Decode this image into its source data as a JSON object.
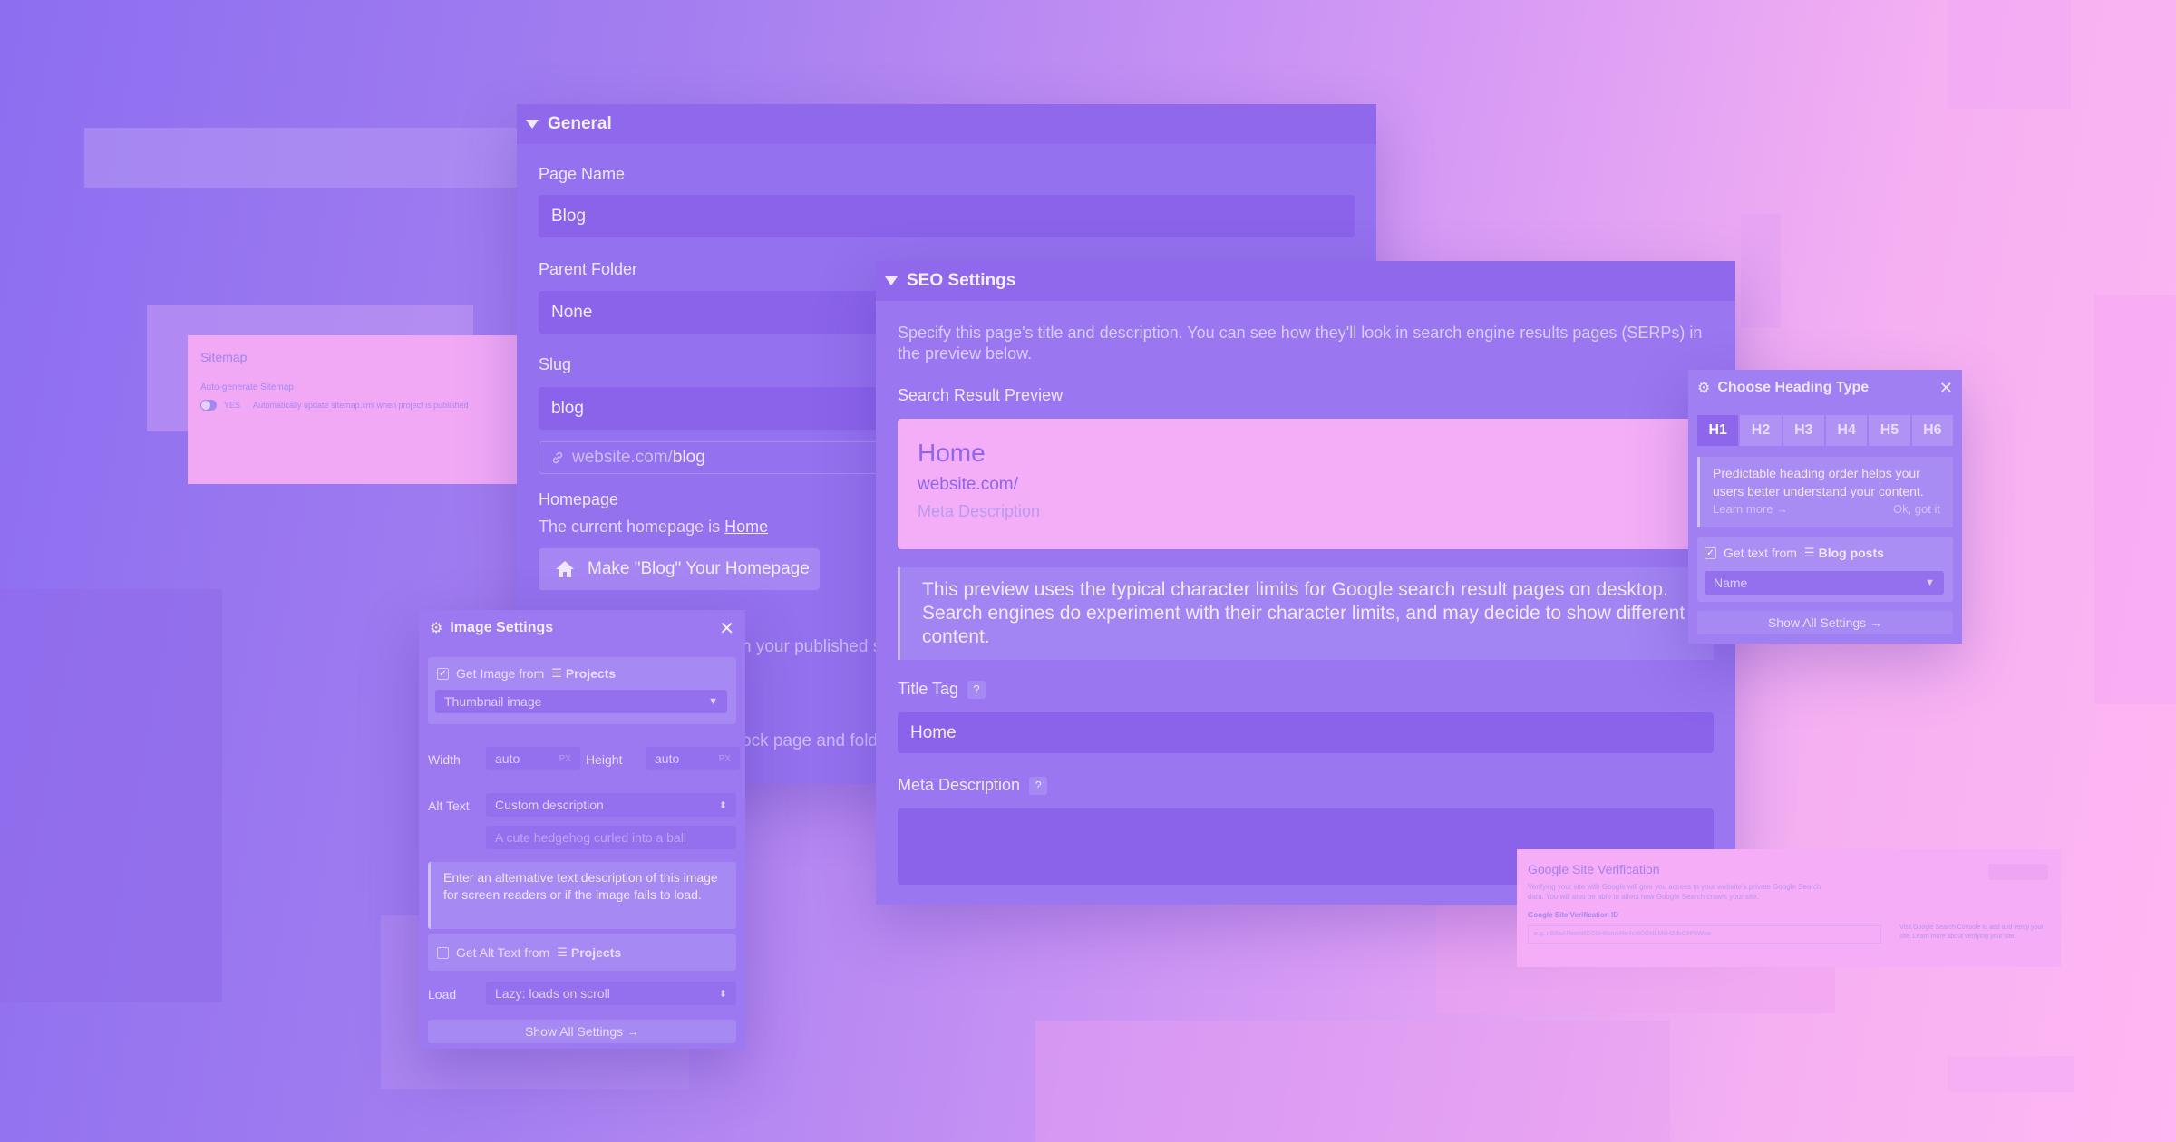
{
  "general": {
    "title": "General",
    "page_name_label": "Page Name",
    "page_name_value": "Blog",
    "parent_folder_label": "Parent Folder",
    "parent_folder_value": "None",
    "slug_label": "Slug",
    "slug_value": "blog",
    "slug_url_prefix": "website.com/",
    "slug_url_slug": "blog",
    "homepage_label": "Homepage",
    "homepage_text": "The current homepage is ",
    "homepage_link": "Home",
    "make_home_button": "Make \"Blog\" Your Homepage",
    "partial_text_1": "n your published s",
    "partial_text_2": "ock page and fold"
  },
  "sitemap": {
    "title": "Sitemap",
    "subtitle": "Auto-generate Sitemap",
    "toggle_label": "YES",
    "toggle_desc": "Automatically update sitemap.xml when project is published"
  },
  "seo": {
    "title": "SEO Settings",
    "description": "Specify this page's title and description. You can see how they'll look in search engine results pages (SERPs) in the preview below.",
    "preview_label": "Search Result Preview",
    "preview_title": "Home",
    "preview_url": "website.com/",
    "preview_meta": "Meta Description",
    "note": "This preview uses the typical character limits for Google search result pages on desktop. Search engines do experiment with their character limits, and may decide to show different content.",
    "title_tag_label": "Title Tag",
    "title_tag_value": "Home",
    "meta_description_label": "Meta Description",
    "help_glyph": "?"
  },
  "image_settings": {
    "title": "Image Settings",
    "close_glyph": "✕",
    "get_image_from": "Get Image from",
    "projects": "Projects",
    "source_field": "Thumbnail image",
    "width_label": "Width",
    "width_value": "auto",
    "height_label": "Height",
    "height_value": "auto",
    "unit": "PX",
    "alt_text_label": "Alt Text",
    "alt_text_mode": "Custom description",
    "alt_text_placeholder": "A cute hedgehog curled into a ball",
    "alt_note": "Enter an alternative text description of this image for screen readers or if the image fails to load.",
    "get_alt_from": "Get Alt Text from",
    "load_label": "Load",
    "load_value": "Lazy: loads on scroll",
    "show_all": "Show All Settings →"
  },
  "heading_type": {
    "title": "Choose Heading Type",
    "close_glyph": "✕",
    "tabs": [
      "H1",
      "H2",
      "H3",
      "H4",
      "H5",
      "H6"
    ],
    "active_tab": "H1",
    "note": "Predictable heading order helps your users better understand your content.",
    "learn_more": "Learn more →",
    "ok": "Ok, got it",
    "get_text_from": "Get text from",
    "blog_posts": "Blog posts",
    "field_value": "Name",
    "show_all": "Show All Settings →"
  },
  "google_verification": {
    "title": "Google Site Verification",
    "description": "Verifying your site with Google will give you access to your website's private Google Search data. You will also be able to affect how Google Search crawls your site.",
    "field_label": "Google Site Verification ID",
    "field_placeholder": "e.g. aBBaAf4mmBDGbH8xmM4e4cI6D0XtLMkHZdkC9P6Wxw",
    "side_text": "Visit Google Search Console to add and verify your site. Learn more about verifying your site."
  },
  "colors": {
    "accent": "#8d66ec",
    "panel": "#9471ee",
    "preview_bg": "#f4aef7"
  },
  "icons": [
    "triangle-down-icon",
    "link-icon",
    "home-icon",
    "gear-icon",
    "close-icon",
    "check-icon",
    "stack-icon",
    "chevron-down-icon",
    "arrow-right-icon",
    "question-icon"
  ]
}
